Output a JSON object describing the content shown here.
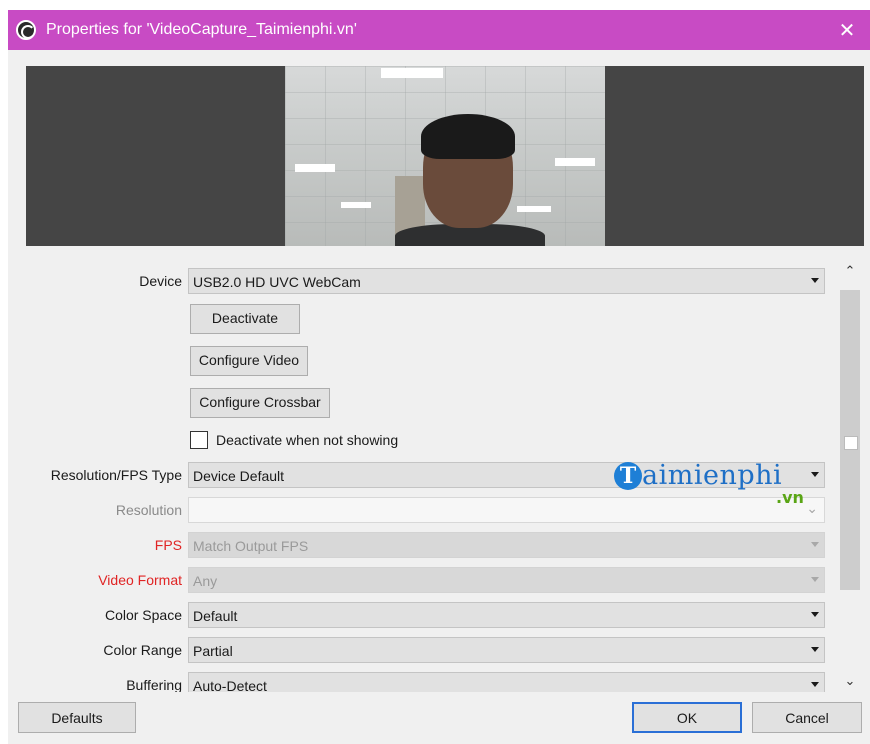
{
  "window": {
    "title": "Properties for 'VideoCapture_Taimienphi.vn'",
    "app_icon": "obs-icon",
    "close_icon": "close-icon",
    "close_glyph": "✕",
    "titlebar_color": "#c84bc4"
  },
  "preview": {
    "description_icon": "camera-preview"
  },
  "properties": {
    "device": {
      "label": "Device",
      "value": "USB2.0 HD UVC WebCam"
    },
    "deactivate_button": "Deactivate",
    "configure_video_button": "Configure Video",
    "configure_crossbar_button": "Configure Crossbar",
    "deactivate_when_not_showing": {
      "label": "Deactivate when not showing",
      "checked": false
    },
    "resolution_fps_type": {
      "label": "Resolution/FPS Type",
      "value": "Device Default"
    },
    "resolution": {
      "label": "Resolution",
      "value": ""
    },
    "fps": {
      "label": "FPS",
      "value": "Match Output FPS"
    },
    "video_format": {
      "label": "Video Format",
      "value": "Any"
    },
    "color_space": {
      "label": "Color Space",
      "value": "Default"
    },
    "color_range": {
      "label": "Color Range",
      "value": "Partial"
    },
    "buffering": {
      "label": "Buffering",
      "value": "Auto-Detect"
    }
  },
  "scrollbar": {
    "up_glyph": "^",
    "down_glyph": "v"
  },
  "watermark": {
    "letter": "T",
    "text": "aimienphi",
    "suffix": ".vn"
  },
  "footer": {
    "defaults_button": "Defaults",
    "ok_button": "OK",
    "cancel_button": "Cancel"
  },
  "colors": {
    "error_label": "#e02424",
    "accent": "#2a6fd6"
  }
}
